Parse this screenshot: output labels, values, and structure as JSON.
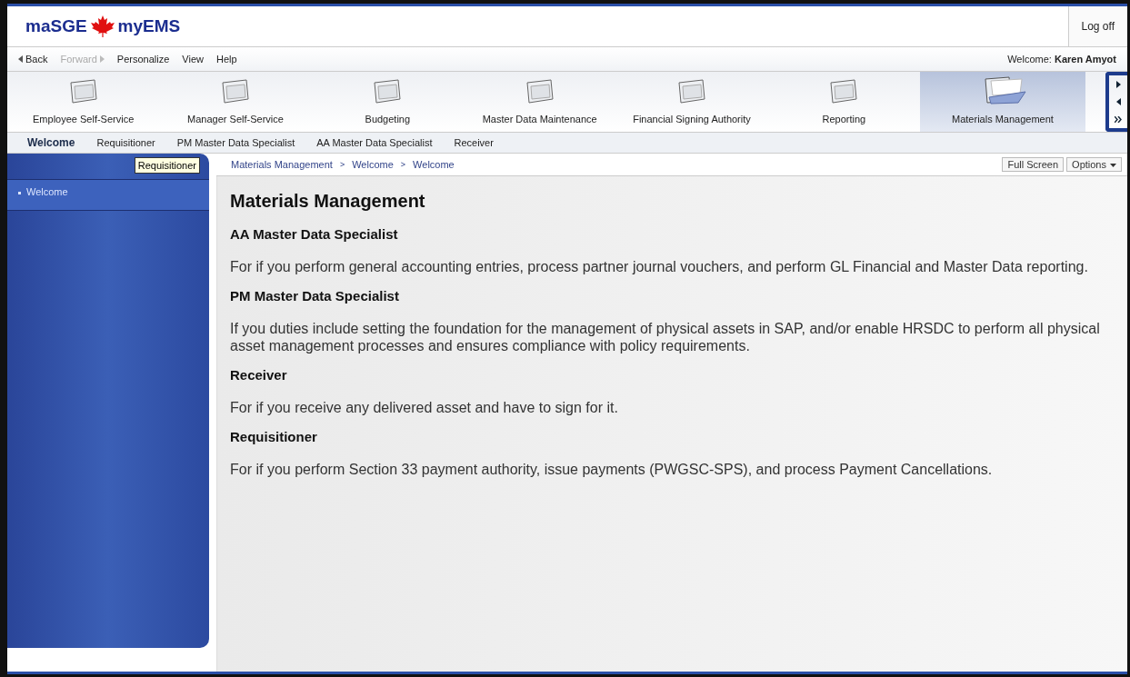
{
  "logo": {
    "left": "maSGE",
    "right": "myEMS"
  },
  "logoff": "Log off",
  "nav": [
    {
      "label": "Back",
      "kind": "back",
      "disabled": false
    },
    {
      "label": "Forward",
      "kind": "forward",
      "disabled": true
    },
    {
      "label": "Personalize",
      "kind": "menu",
      "disabled": false
    },
    {
      "label": "View",
      "kind": "menu",
      "disabled": false
    },
    {
      "label": "Help",
      "kind": "menu",
      "disabled": false
    }
  ],
  "welcome": {
    "prefix": "Welcome:",
    "name": "Karen Amyot"
  },
  "launchpad": [
    {
      "label": "Employee Self-Service",
      "selected": false
    },
    {
      "label": "Manager Self-Service",
      "selected": false
    },
    {
      "label": "Budgeting",
      "selected": false
    },
    {
      "label": "Master Data Maintenance",
      "selected": false
    },
    {
      "label": "Financial Signing Authority",
      "selected": false
    },
    {
      "label": "Reporting",
      "selected": false
    },
    {
      "label": "Materials Management",
      "selected": true
    }
  ],
  "subtabs": [
    {
      "label": "Welcome",
      "selected": true
    },
    {
      "label": "Requisitioner",
      "selected": false
    },
    {
      "label": "PM Master Data Specialist",
      "selected": false
    },
    {
      "label": "AA Master Data Specialist",
      "selected": false
    },
    {
      "label": "Receiver",
      "selected": false
    }
  ],
  "tooltip": "Requisitioner",
  "sidebar": {
    "items": [
      {
        "label": "Welcome",
        "selected": true
      }
    ]
  },
  "breadcrumb": [
    "Materials Management",
    "Welcome",
    "Welcome"
  ],
  "breadcrumb_separator": ">",
  "toolbar": [
    {
      "label": "Full Screen",
      "kind": "button"
    },
    {
      "label": "Options",
      "kind": "dropdown"
    }
  ],
  "content": {
    "title": "Materials Management",
    "sections": [
      {
        "heading": "AA Master Data Specialist",
        "text": "For if you perform general accounting entries, process partner journal vouchers, and perform GL Financial and Master Data reporting."
      },
      {
        "heading": "PM Master Data Specialist",
        "text": "If you duties include setting the foundation for the management of physical assets in SAP, and/or enable HRSDC to perform all physical asset management processes and ensures compliance with policy requirements."
      },
      {
        "heading": "Receiver",
        "text": "For if you receive any delivered asset and have to sign for it."
      },
      {
        "heading": "Requisitioner",
        "text": "For if you perform Section 33 payment authority, issue payments (PWGSC-SPS), and process Payment Cancellations."
      }
    ]
  }
}
